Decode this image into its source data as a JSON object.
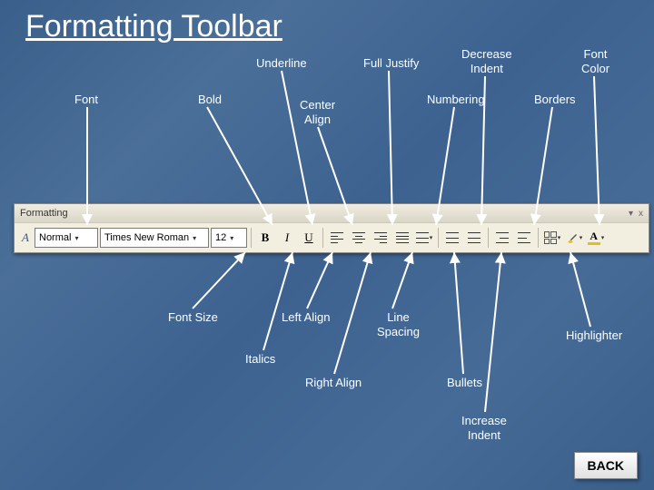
{
  "title": "Formatting Toolbar",
  "toolbar": {
    "header": "Formatting",
    "style_value": "Normal",
    "font_value": "Times New Roman",
    "size_value": "12",
    "bold_label": "B",
    "italic_label": "I",
    "underline_label": "U",
    "font_color_glyph": "A",
    "close_glyph": "x",
    "menu_glyph": "▾"
  },
  "labels": {
    "font": "Font",
    "bold": "Bold",
    "underline": "Underline",
    "full_justify": "Full Justify",
    "decrease_indent_l1": "Decrease",
    "decrease_indent_l2": "Indent",
    "font_color_l1": "Font",
    "font_color_l2": "Color",
    "center_align_l1": "Center",
    "center_align_l2": "Align",
    "numbering": "Numbering",
    "borders": "Borders",
    "font_size": "Font Size",
    "left_align": "Left Align",
    "line_spacing_l1": "Line",
    "line_spacing_l2": "Spacing",
    "highlighter": "Highlighter",
    "italics": "Italics",
    "right_align": "Right Align",
    "bullets": "Bullets",
    "increase_indent_l1": "Increase",
    "increase_indent_l2": "Indent"
  },
  "back_label": "BACK"
}
